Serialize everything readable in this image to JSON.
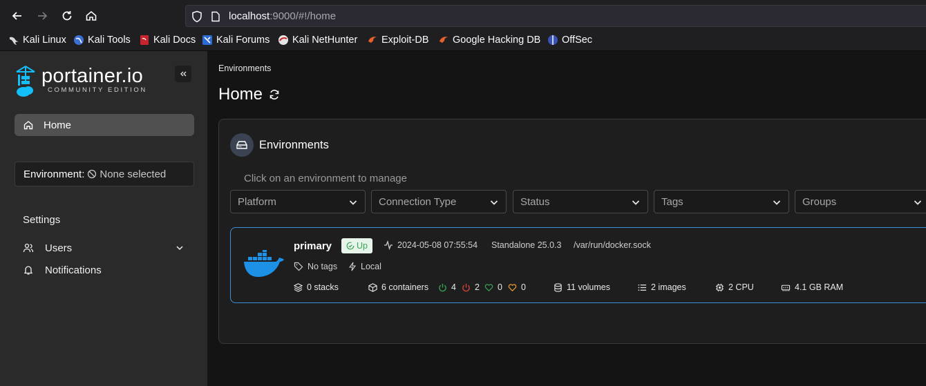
{
  "browser": {
    "url_host": "localhost",
    "url_rest": ":9000/#!/home",
    "bookmarks": [
      "Kali Linux",
      "Kali Tools",
      "Kali Docs",
      "Kali Forums",
      "Kali NetHunter",
      "Exploit-DB",
      "Google Hacking DB",
      "OffSec"
    ]
  },
  "sidebar": {
    "logo_text": "portainer.io",
    "logo_sub": "COMMUNITY EDITION",
    "home_label": "Home",
    "environment_label": "Environment:",
    "environment_value": "None selected",
    "settings_heading": "Settings",
    "items": [
      {
        "label": "Users"
      },
      {
        "label": "Notifications"
      }
    ]
  },
  "main": {
    "breadcrumb": "Environments",
    "title": "Home",
    "card": {
      "title": "Environments",
      "hint": "Click on an environment to manage",
      "filters": [
        "Platform",
        "Connection Type",
        "Status",
        "Tags",
        "Groups"
      ]
    },
    "environment": {
      "name": "primary",
      "status": "Up",
      "timestamp": "2024-05-08 07:55:54",
      "version": "Standalone 25.0.3",
      "socket": "/var/run/docker.sock",
      "tags": "No tags",
      "location": "Local",
      "stacks": "0 stacks",
      "containers": "6 containers",
      "running": "4",
      "stopped": "2",
      "healthy": "0",
      "unhealthy": "0",
      "volumes": "11 volumes",
      "images": "2 images",
      "cpu": "2 CPU",
      "ram": "4.1 GB RAM"
    }
  },
  "colors": {
    "accent": "#3c8fd6",
    "running": "#3aa657",
    "stopped": "#d9453c",
    "unhealthy": "#f0a030"
  }
}
